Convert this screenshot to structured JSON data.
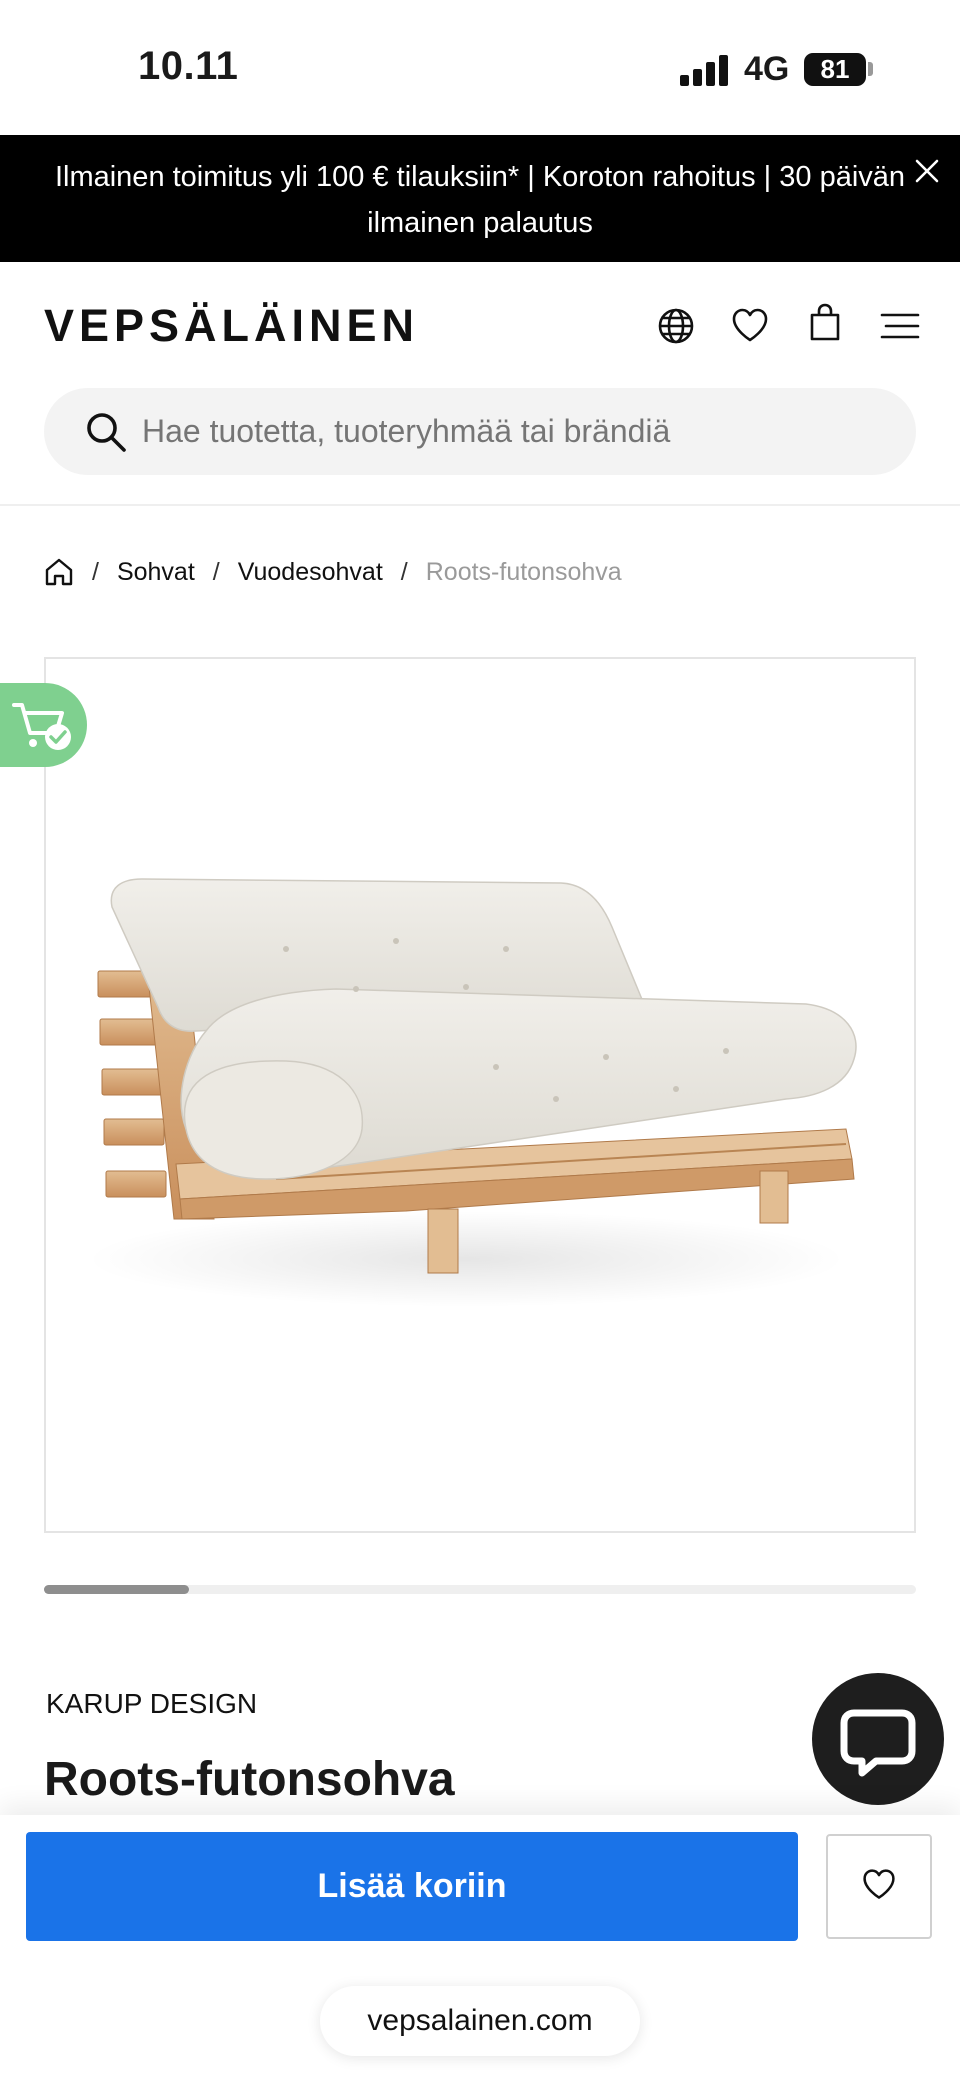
{
  "status_bar": {
    "time": "10.11",
    "network": "4G",
    "battery": "81"
  },
  "promo": {
    "text": "Ilmainen toimitus yli 100 € tilauksiin* | Koroton rahoitus | 30 päivän ilmainen palautus"
  },
  "header": {
    "logo": "VEPSÄLÄINEN"
  },
  "search": {
    "placeholder": "Hae tuotetta, tuoteryhmää tai brändiä"
  },
  "breadcrumb": {
    "items": [
      "Sohvat",
      "Vuodesohvat"
    ],
    "current": "Roots-futonsohva"
  },
  "carousel": {
    "progress": 0.166
  },
  "product": {
    "brand": "KARUP DESIGN",
    "title": "Roots-futonsohva"
  },
  "actions": {
    "add_to_cart": "Lisää koriin"
  },
  "browser": {
    "url": "vepsalainen.com"
  },
  "colors": {
    "accent": "#1a73e8",
    "cart_badge": "#7fd08f",
    "promo_bg": "#000000"
  }
}
